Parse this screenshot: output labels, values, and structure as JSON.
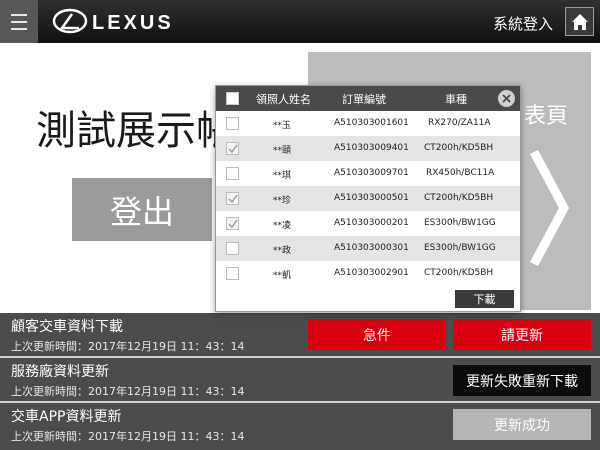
{
  "header": {
    "brand": "LEXUS",
    "login_label": "系統登入",
    "menu_icon": "hamburger-icon",
    "home_icon": "home-icon"
  },
  "main": {
    "title": "測試展示帳",
    "logout_label": "登出",
    "panel_label": "表頁"
  },
  "modal": {
    "columns": [
      "領照人姓名",
      "訂單編號",
      "車種"
    ],
    "rows": [
      {
        "checked": false,
        "name": "**玉",
        "order": "A510303001601",
        "model": "RX270/ZA11A"
      },
      {
        "checked": true,
        "name": "**頤",
        "order": "A510303009401",
        "model": "CT200h/KD5BH"
      },
      {
        "checked": false,
        "name": "**琪",
        "order": "A510303009701",
        "model": "RX450h/BC11A"
      },
      {
        "checked": true,
        "name": "**珍",
        "order": "A510303000501",
        "model": "CT200h/KD5BH"
      },
      {
        "checked": true,
        "name": "**凌",
        "order": "A510303000201",
        "model": "ES300h/BW1GG"
      },
      {
        "checked": false,
        "name": "**政",
        "order": "A510303000301",
        "model": "ES300h/BW1GG"
      },
      {
        "checked": false,
        "name": "**凱",
        "order": "A510303002901",
        "model": "CT200h/KD5BH"
      }
    ],
    "download_label": "下載"
  },
  "sync": {
    "items": [
      {
        "title": "顧客交車資料下載",
        "time": "上次更新時間：2017年12月19日 11：43：14",
        "buttons": [
          "急件",
          "請更新"
        ]
      },
      {
        "title": "服務廠資料更新",
        "time": "上次更新時間：2017年12月19日 11：43：14",
        "buttons": [
          "更新失敗重新下載"
        ]
      },
      {
        "title": "交車APP資料更新",
        "time": "上次更新時間：2017年12月19日 11：43：14",
        "buttons": [
          "更新成功"
        ]
      }
    ]
  },
  "colors": {
    "header_bg": "#1c1c1c",
    "urgent_red": "#d9000f",
    "bottom_bg": "#4c4c4c",
    "success_gray": "#b5b5b5"
  }
}
